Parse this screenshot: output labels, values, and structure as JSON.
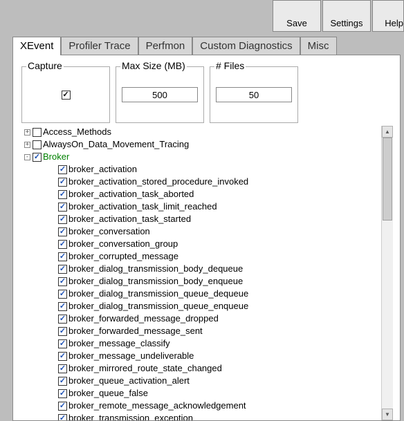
{
  "toolbar": {
    "save": "Save",
    "settings": "Settings",
    "help": "Help"
  },
  "tabs": {
    "xevent": "XEvent",
    "profiler": "Profiler Trace",
    "perfmon": "Perfmon",
    "custom": "Custom Diagnostics",
    "misc": "Misc"
  },
  "panel": {
    "capture_label": "Capture",
    "capture_checked": true,
    "maxsize_label": "Max Size (MB)",
    "maxsize_value": "500",
    "files_label": "# Files",
    "files_value": "50"
  },
  "tree": {
    "items": [
      {
        "label": "Access_Methods",
        "expand": "+",
        "checked": false,
        "indent": 1,
        "green": false
      },
      {
        "label": "AlwaysOn_Data_Movement_Tracing",
        "expand": "+",
        "checked": false,
        "indent": 1,
        "green": false
      },
      {
        "label": "Broker",
        "expand": "-",
        "checked": true,
        "indent": 1,
        "green": true
      },
      {
        "label": "broker_activation",
        "expand": "",
        "checked": true,
        "indent": 2,
        "green": false
      },
      {
        "label": "broker_activation_stored_procedure_invoked",
        "expand": "",
        "checked": true,
        "indent": 2,
        "green": false
      },
      {
        "label": "broker_activation_task_aborted",
        "expand": "",
        "checked": true,
        "indent": 2,
        "green": false
      },
      {
        "label": "broker_activation_task_limit_reached",
        "expand": "",
        "checked": true,
        "indent": 2,
        "green": false
      },
      {
        "label": "broker_activation_task_started",
        "expand": "",
        "checked": true,
        "indent": 2,
        "green": false
      },
      {
        "label": "broker_conversation",
        "expand": "",
        "checked": true,
        "indent": 2,
        "green": false
      },
      {
        "label": "broker_conversation_group",
        "expand": "",
        "checked": true,
        "indent": 2,
        "green": false
      },
      {
        "label": "broker_corrupted_message",
        "expand": "",
        "checked": true,
        "indent": 2,
        "green": false
      },
      {
        "label": "broker_dialog_transmission_body_dequeue",
        "expand": "",
        "checked": true,
        "indent": 2,
        "green": false
      },
      {
        "label": "broker_dialog_transmission_body_enqueue",
        "expand": "",
        "checked": true,
        "indent": 2,
        "green": false
      },
      {
        "label": "broker_dialog_transmission_queue_dequeue",
        "expand": "",
        "checked": true,
        "indent": 2,
        "green": false
      },
      {
        "label": "broker_dialog_transmission_queue_enqueue",
        "expand": "",
        "checked": true,
        "indent": 2,
        "green": false
      },
      {
        "label": "broker_forwarded_message_dropped",
        "expand": "",
        "checked": true,
        "indent": 2,
        "green": false
      },
      {
        "label": "broker_forwarded_message_sent",
        "expand": "",
        "checked": true,
        "indent": 2,
        "green": false
      },
      {
        "label": "broker_message_classify",
        "expand": "",
        "checked": true,
        "indent": 2,
        "green": false
      },
      {
        "label": "broker_message_undeliverable",
        "expand": "",
        "checked": true,
        "indent": 2,
        "green": false
      },
      {
        "label": "broker_mirrored_route_state_changed",
        "expand": "",
        "checked": true,
        "indent": 2,
        "green": false
      },
      {
        "label": "broker_queue_activation_alert",
        "expand": "",
        "checked": true,
        "indent": 2,
        "green": false
      },
      {
        "label": "broker_queue_false",
        "expand": "",
        "checked": true,
        "indent": 2,
        "green": false
      },
      {
        "label": "broker_remote_message_acknowledgement",
        "expand": "",
        "checked": true,
        "indent": 2,
        "green": false
      },
      {
        "label": "broker_transmission_exception",
        "expand": "",
        "checked": true,
        "indent": 2,
        "green": false
      }
    ]
  }
}
